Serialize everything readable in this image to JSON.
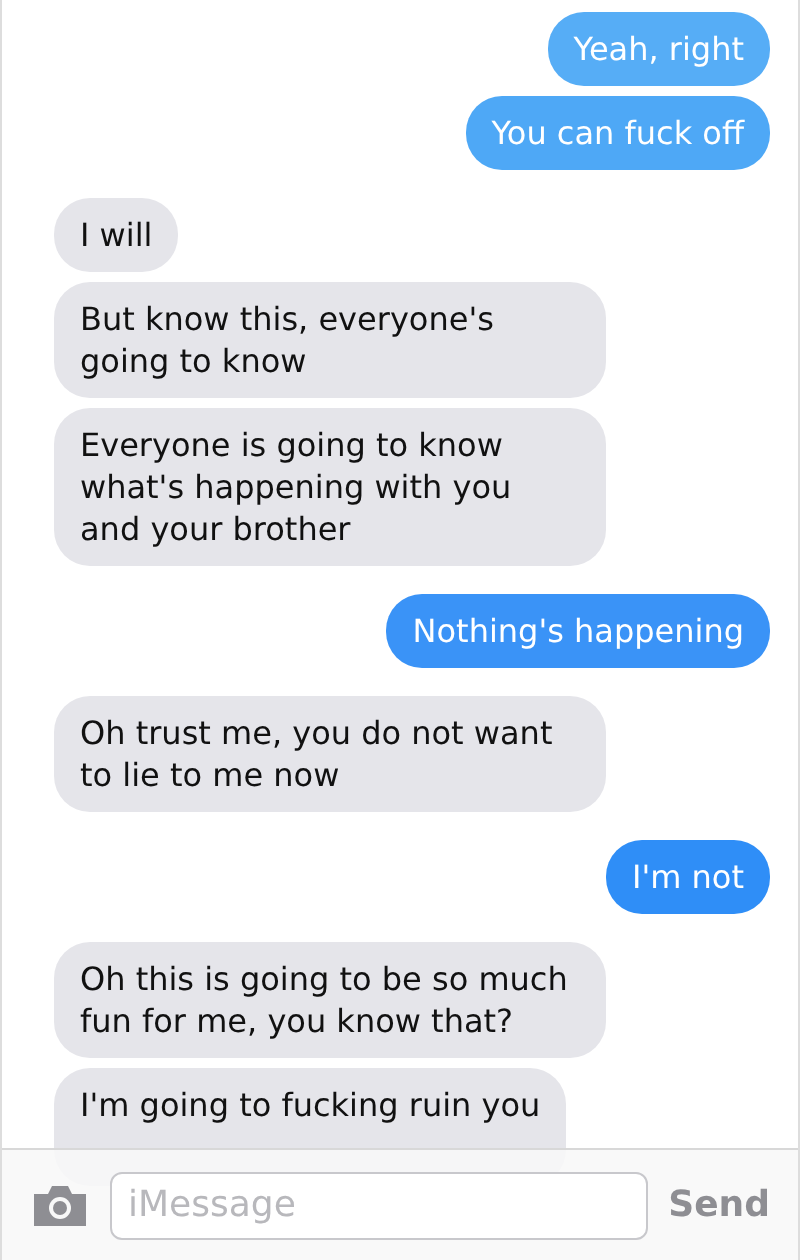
{
  "messages": [
    {
      "kind": "sent",
      "text": "Yeah, right",
      "color": "#56adf6"
    },
    {
      "kind": "sent",
      "text": "You can fuck off",
      "color": "#4ea8f6"
    },
    {
      "kind": "received",
      "text": "I will"
    },
    {
      "kind": "received",
      "text": "But know this, everyone's going to know"
    },
    {
      "kind": "received",
      "text": "Everyone is going to know what's happening with you and your brother"
    },
    {
      "kind": "sent",
      "text": "Nothing's happening",
      "color": "#3a93f7"
    },
    {
      "kind": "received",
      "text": "Oh trust me, you do not want to lie to me now"
    },
    {
      "kind": "sent",
      "text": "I'm not",
      "color": "#2f8ef7"
    },
    {
      "kind": "received",
      "text": "Oh this is going to be so much fun for me, you know that?"
    },
    {
      "kind": "received",
      "text": "I'm going to fucking ruin you"
    }
  ],
  "composer": {
    "placeholder": "iMessage",
    "send": "Send"
  }
}
